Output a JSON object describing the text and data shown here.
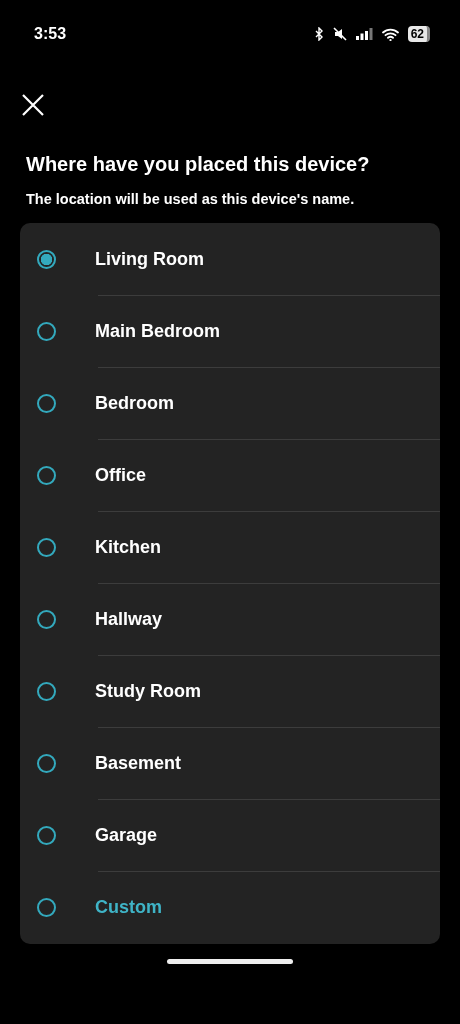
{
  "status_bar": {
    "time": "3:53",
    "battery": "62"
  },
  "title": "Where have you placed this device?",
  "subtitle": "The location will be used as this device's name.",
  "options": [
    {
      "label": "Living Room",
      "selected": true,
      "kind": "preset"
    },
    {
      "label": "Main Bedroom",
      "selected": false,
      "kind": "preset"
    },
    {
      "label": "Bedroom",
      "selected": false,
      "kind": "preset"
    },
    {
      "label": "Office",
      "selected": false,
      "kind": "preset"
    },
    {
      "label": "Kitchen",
      "selected": false,
      "kind": "preset"
    },
    {
      "label": "Hallway",
      "selected": false,
      "kind": "preset"
    },
    {
      "label": "Study Room",
      "selected": false,
      "kind": "preset"
    },
    {
      "label": "Basement",
      "selected": false,
      "kind": "preset"
    },
    {
      "label": "Garage",
      "selected": false,
      "kind": "preset"
    },
    {
      "label": "Custom",
      "selected": false,
      "kind": "custom"
    }
  ]
}
